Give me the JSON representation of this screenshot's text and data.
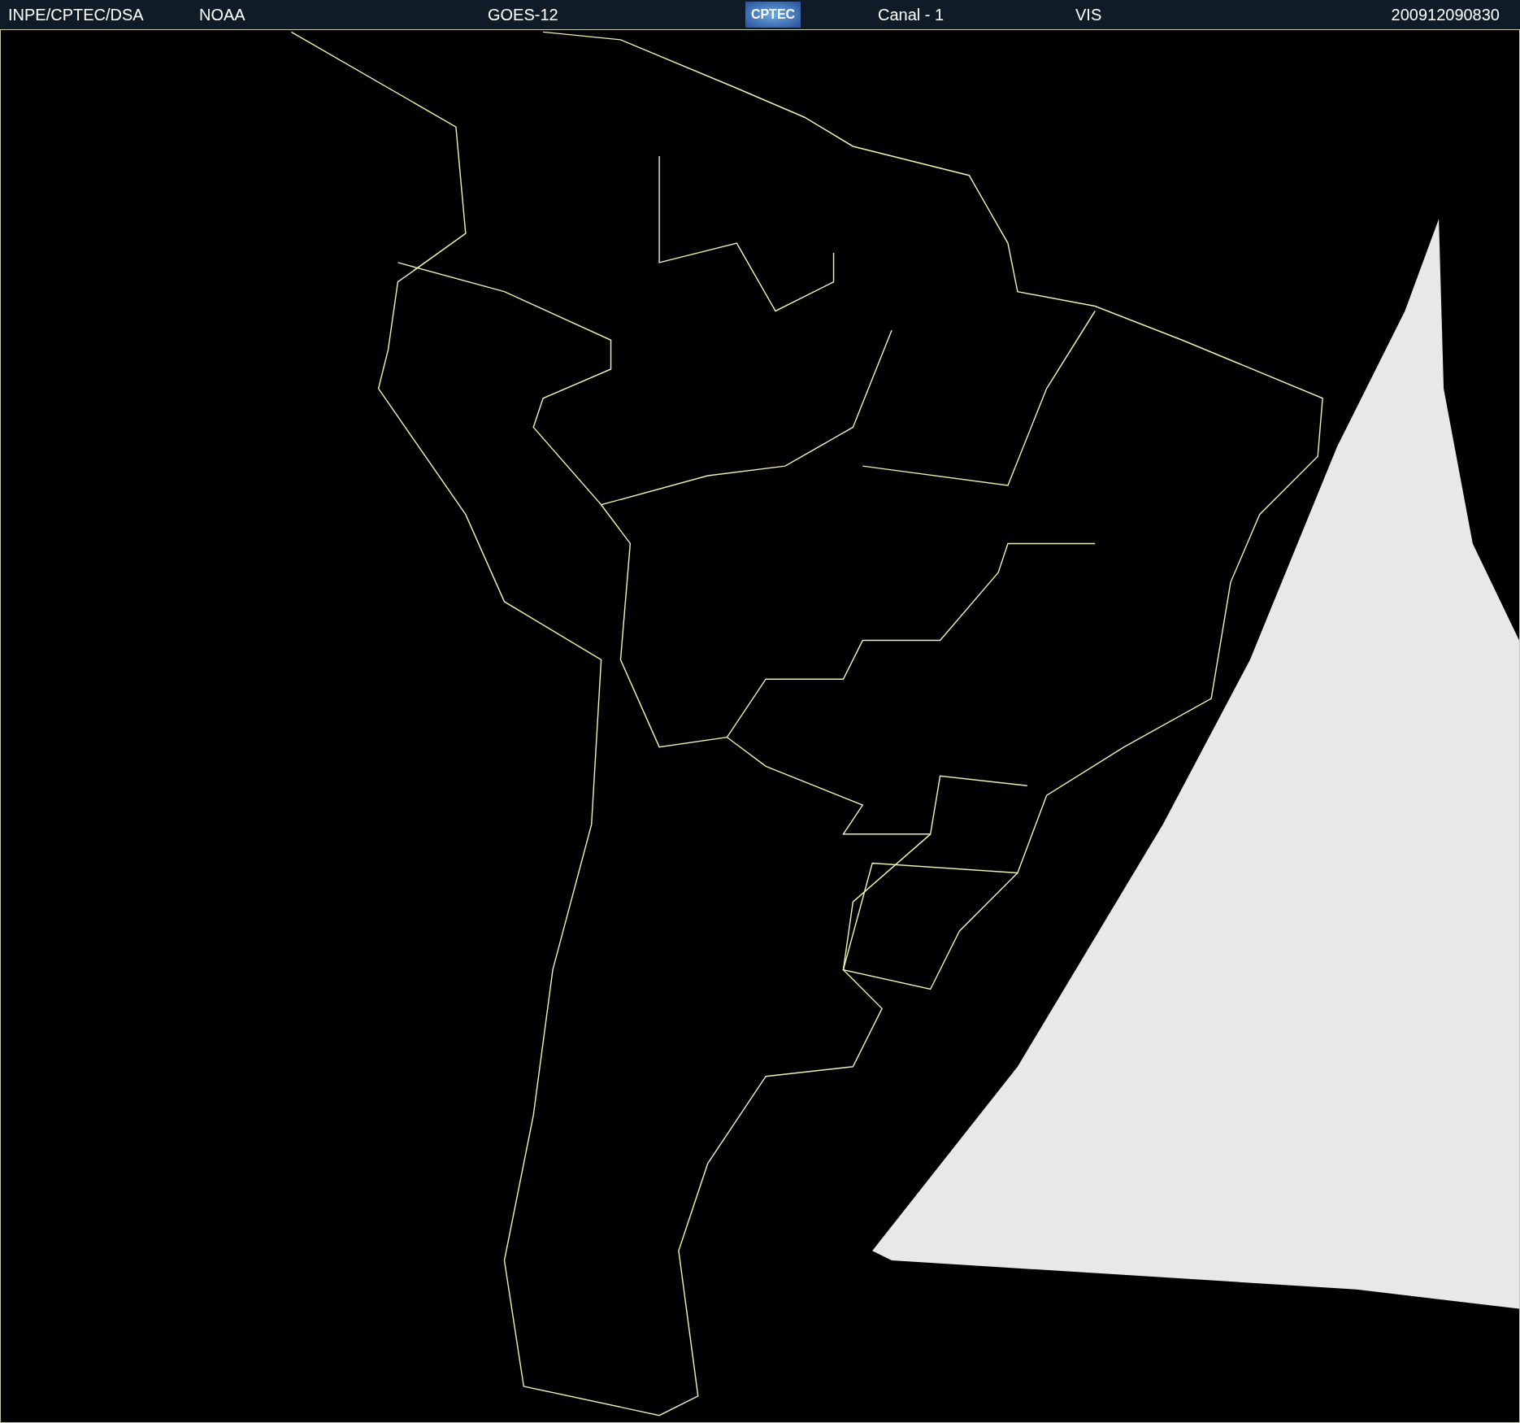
{
  "header": {
    "source": "INPE/CPTEC/DSA",
    "agency": "NOAA",
    "satellite": "GOES-12",
    "logo": "CPTEC",
    "channel": "Canal - 1",
    "band": "VIS",
    "timestamp": "200912090830"
  }
}
